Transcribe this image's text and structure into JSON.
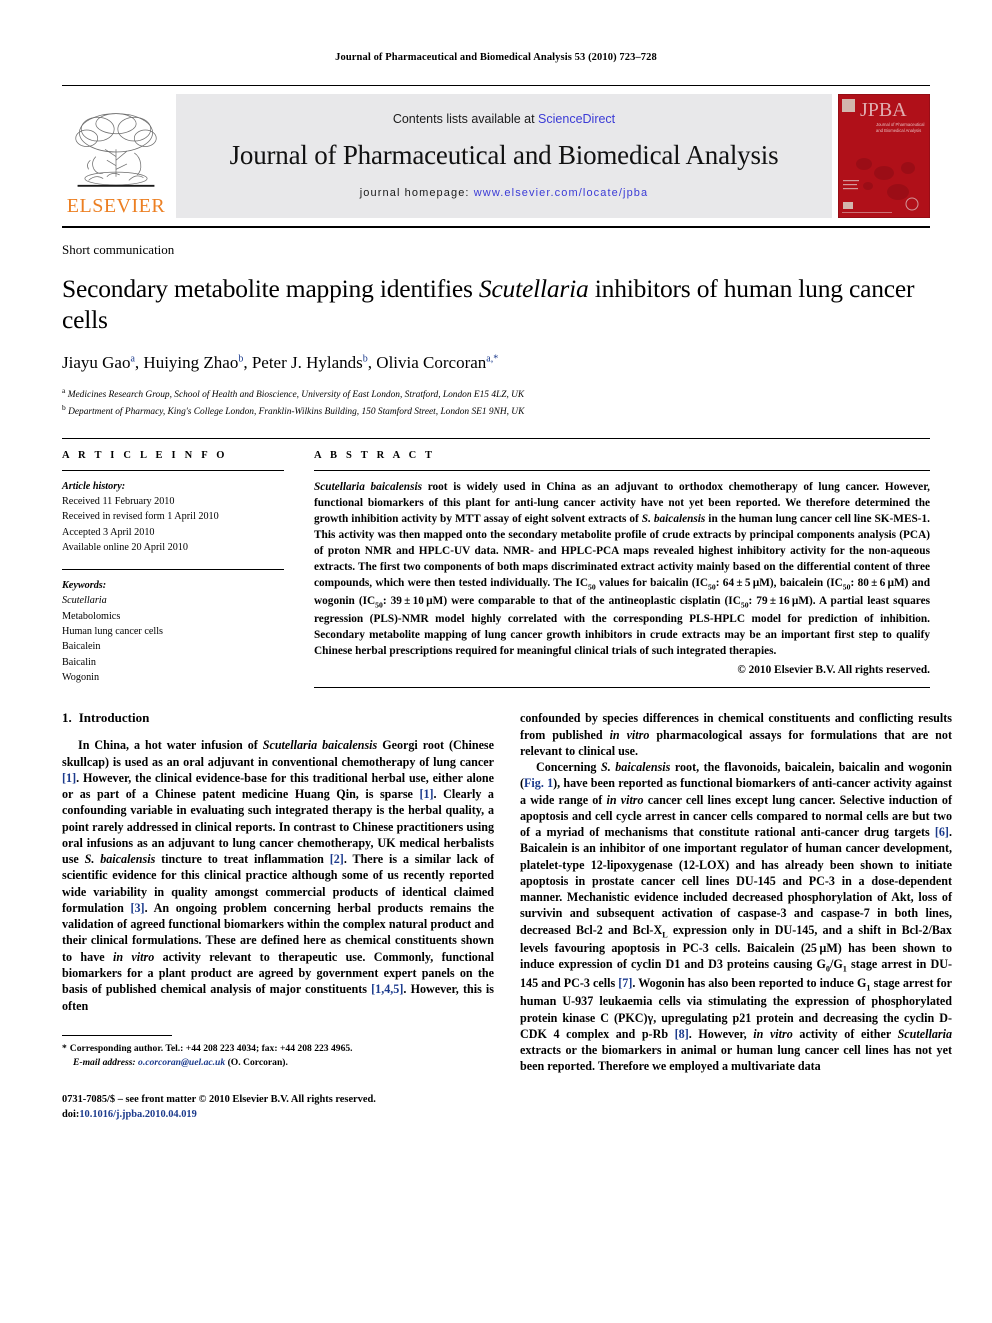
{
  "running_head": "Journal of Pharmaceutical and Biomedical Analysis 53 (2010) 723–728",
  "masthead": {
    "publisher_name": "ELSEVIER",
    "contents_prefix": "Contents lists available at ",
    "contents_link": "ScienceDirect",
    "journal_name": "Journal of Pharmaceutical and Biomedical Analysis",
    "homepage_prefix": "journal homepage:",
    "homepage_url": "www.elsevier.com/locate/jpba",
    "cover_title": "JPBA",
    "cover_subtitle": "Journal of Pharmaceutical and Biomedical Analysis",
    "cover_color": "#b01019",
    "link_color": "#3b3bd6",
    "elsevier_orange": "#ec7f22"
  },
  "article": {
    "doctype": "Short communication",
    "title_part1": "Secondary metabolite mapping identifies ",
    "title_italic": "Scutellaria",
    "title_part2": " inhibitors of human lung cancer cells",
    "authors": [
      {
        "name": "Jiayu Gao",
        "sup": "a",
        "sep": ", "
      },
      {
        "name": "Huiying Zhao",
        "sup": "b",
        "sep": ", "
      },
      {
        "name": "Peter J. Hylands",
        "sup": "b",
        "sep": ", "
      },
      {
        "name": "Olivia Corcoran",
        "sup": "a,*",
        "sep": ""
      }
    ],
    "affiliations": [
      {
        "mark": "a",
        "text": "Medicines Research Group, School of Health and Bioscience, University of East London, Stratford, London E15 4LZ, UK"
      },
      {
        "mark": "b",
        "text": "Department of Pharmacy, King's College London, Franklin-Wilkins Building, 150 Stamford Street, London SE1 9NH, UK"
      }
    ]
  },
  "article_info": {
    "heading": "A R T I C L E    I N F O",
    "history_label": "Article history:",
    "history": [
      "Received 11 February 2010",
      "Received in revised form 1 April 2010",
      "Accepted 3 April 2010",
      "Available online 20 April 2010"
    ],
    "keywords_label": "Keywords:",
    "keywords": [
      {
        "text": "Scutellaria",
        "italic": true
      },
      {
        "text": "Metabolomics",
        "italic": false
      },
      {
        "text": "Human lung cancer cells",
        "italic": false
      },
      {
        "text": "Baicalein",
        "italic": false
      },
      {
        "text": "Baicalin",
        "italic": false
      },
      {
        "text": "Wogonin",
        "italic": false
      }
    ]
  },
  "abstract": {
    "heading": "A B S T R A C T",
    "copyright": "© 2010 Elsevier B.V. All rights reserved."
  },
  "introduction": {
    "number": "1.",
    "heading": "Introduction"
  },
  "footnote": {
    "star": "*",
    "corresponding": "Corresponding author. Tel.: +44 208 223 4034; fax: +44 208 223 4965.",
    "email_label": "E-mail address:",
    "email": "o.corcoran@uel.ac.uk",
    "email_suffix": "(O. Corcoran)."
  },
  "imprint": {
    "line1": "0731-7085/$ – see front matter © 2010 Elsevier B.V. All rights reserved.",
    "doi_label": "doi:",
    "doi": "10.1016/j.jpba.2010.04.019"
  }
}
